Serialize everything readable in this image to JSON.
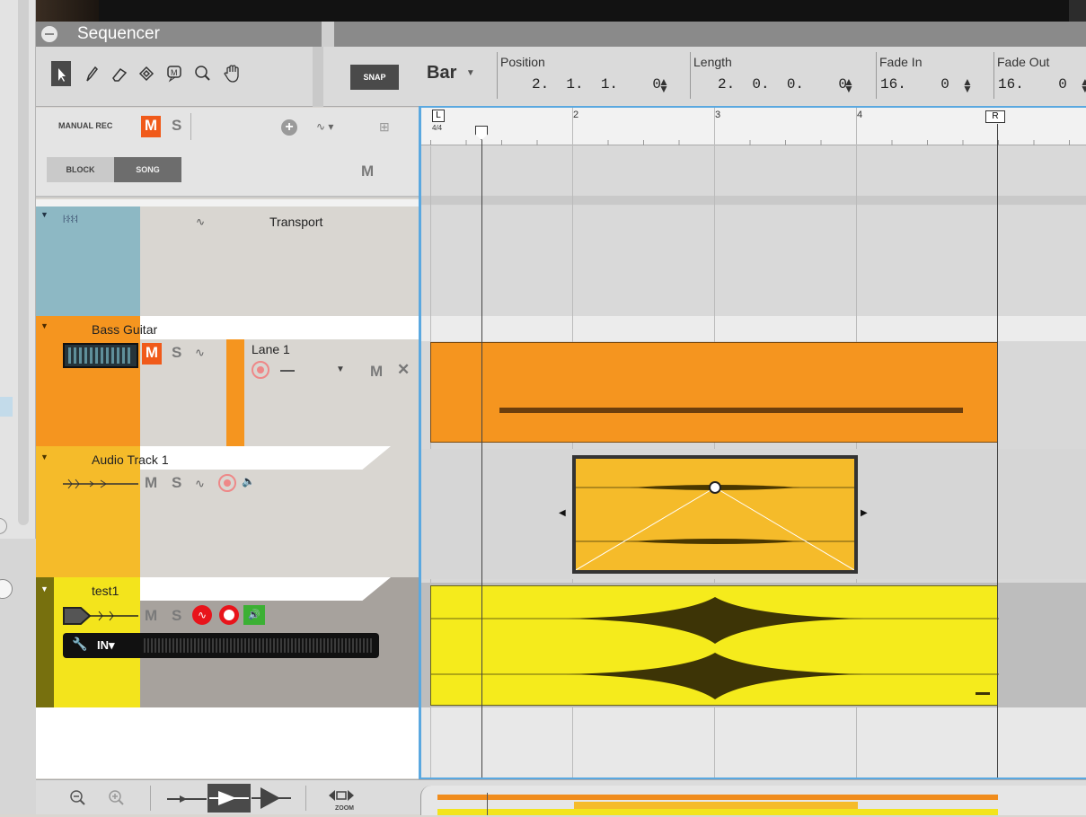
{
  "window": {
    "title": "Sequencer"
  },
  "toolbar": {
    "tools": [
      "select-arrow-icon",
      "pencil-icon",
      "eraser-icon",
      "razor-icon",
      "mute-tool-icon",
      "magnify-icon",
      "hand-icon"
    ],
    "snap_label": "SNAP",
    "snap_value": "Bar",
    "position": {
      "label": "Position",
      "value": "2.  1.  1.    0"
    },
    "length": {
      "label": "Length",
      "value": "2.  0.  0.    0"
    },
    "fade_in": {
      "label": "Fade In",
      "value": "16.    0"
    },
    "fade_out": {
      "label": "Fade Out",
      "value": "16.    0"
    }
  },
  "track_header": {
    "manual_rec": "MANUAL REC",
    "m": "M",
    "s": "S",
    "block": "BLOCK",
    "song": "SONG",
    "m2": "M"
  },
  "ruler": {
    "left_locator": "L",
    "time_sig": "4/4",
    "bars": [
      "2",
      "3",
      "4"
    ],
    "right_locator": "R"
  },
  "tracks": [
    {
      "name": "Transport",
      "color": "#8db8c4"
    },
    {
      "name": "Bass Guitar",
      "lane": "Lane 1",
      "m": "M",
      "s": "S",
      "lane_m": "M",
      "lane_x": "✕",
      "color": "#f5951f"
    },
    {
      "name": "Audio Track 1",
      "m": "M",
      "s": "S",
      "color": "#f5bb2a"
    },
    {
      "name": "test1",
      "m": "M",
      "s": "S",
      "input": "IN",
      "color": "#f3e41c"
    }
  ],
  "bottom": {
    "zoom_label": "ZOOM"
  }
}
